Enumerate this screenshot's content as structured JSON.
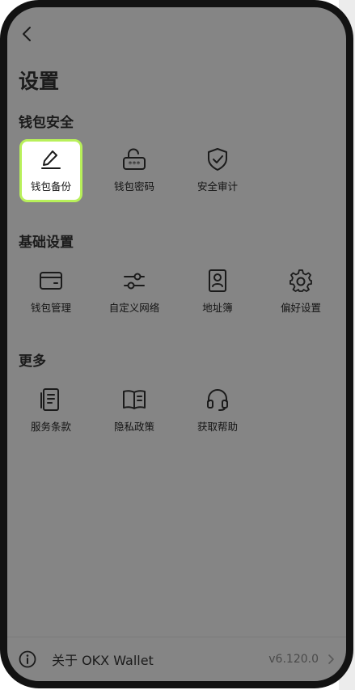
{
  "page": {
    "title": "设置"
  },
  "sections": {
    "wallet_security": {
      "heading": "钱包安全",
      "items": [
        {
          "label": "钱包备份",
          "icon": "pencil-icon"
        },
        {
          "label": "钱包密码",
          "icon": "unlock-password-icon"
        },
        {
          "label": "安全审计",
          "icon": "shield-check-icon"
        }
      ]
    },
    "basic_settings": {
      "heading": "基础设置",
      "items": [
        {
          "label": "钱包管理",
          "icon": "wallet-icon"
        },
        {
          "label": "自定义网络",
          "icon": "sliders-icon"
        },
        {
          "label": "地址簿",
          "icon": "address-book-icon"
        },
        {
          "label": "偏好设置",
          "icon": "gear-icon"
        }
      ]
    },
    "more": {
      "heading": "更多",
      "items": [
        {
          "label": "服务条款",
          "icon": "document-icon"
        },
        {
          "label": "隐私政策",
          "icon": "book-icon"
        },
        {
          "label": "获取帮助",
          "icon": "headset-icon"
        }
      ]
    }
  },
  "footer": {
    "about": "关于 OKX Wallet",
    "version": "v6.120.0"
  },
  "colors": {
    "overlay": "#858585",
    "highlight_border": "#b8f05a",
    "frame": "#121212"
  }
}
